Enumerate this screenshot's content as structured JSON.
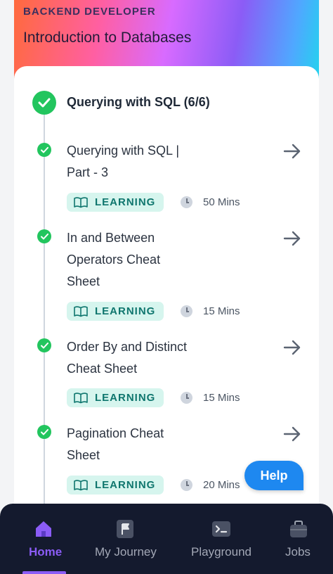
{
  "header": {
    "track": "BACKEND DEVELOPER",
    "course": "Introduction to Databases"
  },
  "section": {
    "title": "Querying with SQL (6/6)"
  },
  "items": [
    {
      "title_lines": [
        "Querying with SQL |",
        "Part - 3"
      ],
      "badge": "LEARNING",
      "duration": "50 Mins"
    },
    {
      "title_lines": [
        "In and Between",
        "Operators Cheat",
        "Sheet"
      ],
      "badge": "LEARNING",
      "duration": "15 Mins"
    },
    {
      "title_lines": [
        "Order By and Distinct",
        "Cheat Sheet"
      ],
      "badge": "LEARNING",
      "duration": "15 Mins"
    },
    {
      "title_lines": [
        "Pagination Cheat",
        "Sheet"
      ],
      "badge": "LEARNING",
      "duration": "20 Mins"
    }
  ],
  "help_label": "Help",
  "nav": [
    {
      "label": "Home",
      "icon": "home-icon",
      "active": true
    },
    {
      "label": "My Journey",
      "icon": "flag-icon",
      "active": false
    },
    {
      "label": "Playground",
      "icon": "terminal-icon",
      "active": false
    },
    {
      "label": "Jobs",
      "icon": "briefcase-icon",
      "active": false
    }
  ],
  "colors": {
    "accent": "#8b5cf6",
    "success": "#22c55e",
    "badge_bg": "#d6f5ee",
    "badge_text": "#0f766e",
    "help": "#1e88f0",
    "nav_bg": "#141a2e"
  }
}
